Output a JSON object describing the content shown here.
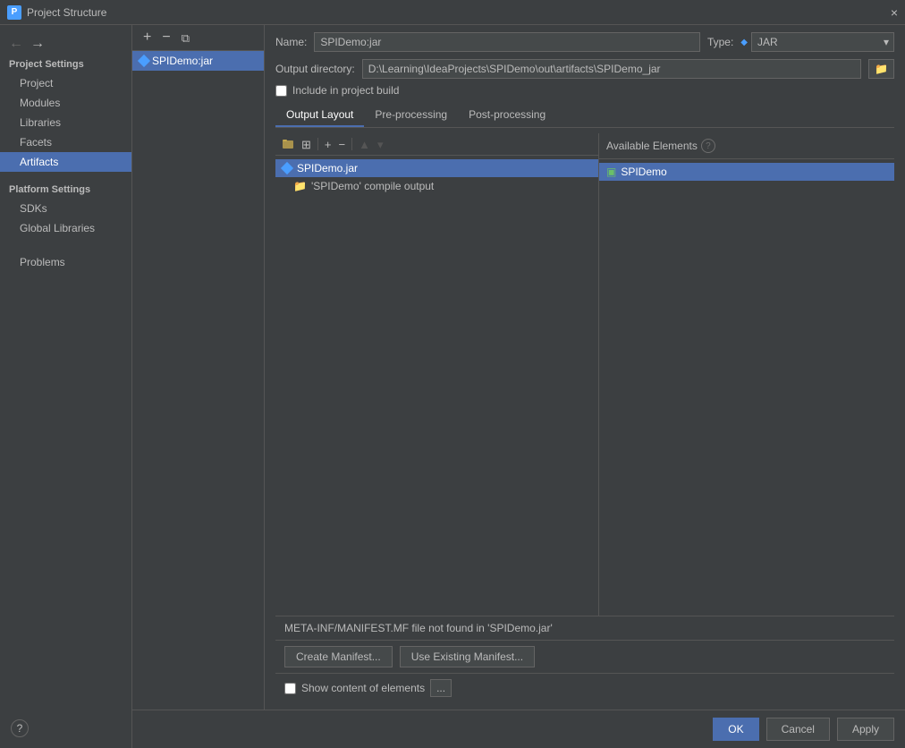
{
  "titleBar": {
    "icon": "P",
    "title": "Project Structure",
    "closeLabel": "×"
  },
  "nav": {
    "backLabel": "←",
    "forwardLabel": "→"
  },
  "sidebar": {
    "projectSettings": {
      "sectionLabel": "Project Settings",
      "items": [
        {
          "id": "project",
          "label": "Project"
        },
        {
          "id": "modules",
          "label": "Modules"
        },
        {
          "id": "libraries",
          "label": "Libraries"
        },
        {
          "id": "facets",
          "label": "Facets"
        },
        {
          "id": "artifacts",
          "label": "Artifacts",
          "active": true
        }
      ]
    },
    "platformSettings": {
      "sectionLabel": "Platform Settings",
      "items": [
        {
          "id": "sdks",
          "label": "SDKs"
        },
        {
          "id": "global-libraries",
          "label": "Global Libraries"
        }
      ]
    },
    "problems": {
      "label": "Problems"
    }
  },
  "artifactsList": {
    "addLabel": "+",
    "removeLabel": "−",
    "copyLabel": "⧉",
    "selectedArtifact": "SPIDemo:jar"
  },
  "rightPanel": {
    "nameLabel": "Name:",
    "nameValue": "SPIDemo:jar",
    "typeLabel": "Type:",
    "typeValue": "JAR",
    "typeIcon": "◆",
    "outputDirLabel": "Output directory:",
    "outputDirValue": "D:\\Learning\\IdeaProjects\\SPIDemo\\out\\artifacts\\SPIDemo_jar",
    "includeInBuildLabel": "Include in project build",
    "includeInBuildChecked": false
  },
  "tabs": [
    {
      "id": "output-layout",
      "label": "Output Layout",
      "active": true
    },
    {
      "id": "pre-processing",
      "label": "Pre-processing"
    },
    {
      "id": "post-processing",
      "label": "Post-processing"
    }
  ],
  "treeToolbar": {
    "buttons": [
      {
        "id": "folder",
        "label": "📁",
        "tooltip": "New folder"
      },
      {
        "id": "grid",
        "label": "⊞",
        "tooltip": "Grid"
      },
      {
        "id": "add",
        "label": "+",
        "tooltip": "Add"
      },
      {
        "id": "remove",
        "label": "−",
        "tooltip": "Remove"
      },
      {
        "id": "move-up",
        "label": "▲",
        "tooltip": "Move up",
        "disabled": true
      },
      {
        "id": "move-down",
        "label": "▾",
        "tooltip": "Move down",
        "disabled": true
      }
    ]
  },
  "treeItems": [
    {
      "id": "spidemo-jar",
      "label": "SPIDemo.jar",
      "level": 0,
      "selected": true,
      "type": "jar"
    },
    {
      "id": "spidemo-compile",
      "label": "'SPIDemo' compile output",
      "level": 1,
      "selected": false,
      "type": "folder"
    }
  ],
  "availableElements": {
    "headerLabel": "Available Elements",
    "infoIcon": "?",
    "items": [
      {
        "id": "spidemo",
        "label": "SPIDemo",
        "type": "module"
      }
    ]
  },
  "warningMessage": "META-INF/MANIFEST.MF file not found in 'SPIDemo.jar'",
  "actionButtons": [
    {
      "id": "create-manifest",
      "label": "Create Manifest..."
    },
    {
      "id": "use-existing-manifest",
      "label": "Use Existing Manifest..."
    }
  ],
  "bottomCheckbox": {
    "label": "Show content of elements",
    "checked": false,
    "moreLabel": "..."
  },
  "bottomBar": {
    "okLabel": "OK",
    "cancelLabel": "Cancel",
    "applyLabel": "Apply"
  },
  "helpLabel": "?"
}
